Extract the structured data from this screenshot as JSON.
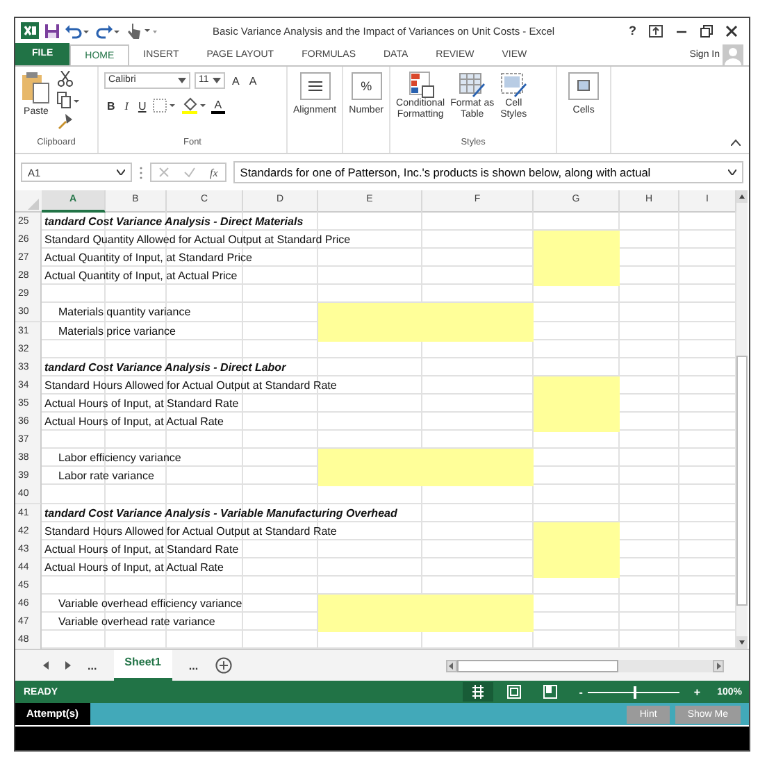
{
  "window": {
    "title": "Basic Variance Analysis and the Impact of Variances on Unit Costs - Excel",
    "help": "?"
  },
  "tabs": [
    {
      "label": "FILE",
      "kind": "file",
      "selected": false
    },
    {
      "label": "HOME",
      "kind": "tab",
      "selected": true
    },
    {
      "label": "INSERT",
      "kind": "tab",
      "selected": false
    },
    {
      "label": "PAGE LAYOUT",
      "kind": "tab",
      "selected": false
    },
    {
      "label": "FORMULAS",
      "kind": "tab",
      "selected": false
    },
    {
      "label": "DATA",
      "kind": "tab",
      "selected": false
    },
    {
      "label": "REVIEW",
      "kind": "tab",
      "selected": false
    },
    {
      "label": "VIEW",
      "kind": "tab",
      "selected": false
    }
  ],
  "sign_in": "Sign In",
  "ribbon": {
    "clipboard": {
      "label": "Clipboard",
      "paste": "Paste"
    },
    "font": {
      "label": "Font",
      "name": "Calibri",
      "size": "11",
      "grow": "A",
      "shrink": "A",
      "bold": "B",
      "italic": "I",
      "underline": "U",
      "color_letter": "A"
    },
    "alignment": "Alignment",
    "number": {
      "label": "Number",
      "symbol": "%"
    },
    "styles": {
      "label": "Styles",
      "buttons": [
        {
          "lines": [
            "Conditional",
            "Formatting"
          ],
          "kind": "conditional"
        },
        {
          "lines": [
            "Format as",
            "Table"
          ],
          "kind": "table"
        },
        {
          "lines": [
            "Cell",
            "Styles"
          ],
          "kind": "cellstyles"
        }
      ]
    },
    "cells": "Cells"
  },
  "formula_bar": {
    "name_box": "A1",
    "fx": "fx",
    "formula": "Standards for one of Patterson, Inc.'s products is shown below, along with actual"
  },
  "columns": [
    {
      "label": "A",
      "selected": true
    },
    {
      "label": "B",
      "selected": false
    },
    {
      "label": "C",
      "selected": false
    },
    {
      "label": "D",
      "selected": false
    },
    {
      "label": "E",
      "selected": false
    },
    {
      "label": "F",
      "selected": false
    },
    {
      "label": "G",
      "selected": false
    },
    {
      "label": "H",
      "selected": false
    },
    {
      "label": "I",
      "selected": false
    }
  ],
  "rows": [
    {
      "number": "25",
      "kind": "heading",
      "text": "tandard Cost Variance Analysis - Direct Materials"
    },
    {
      "number": "26",
      "kind": "item",
      "text": "Standard Quantity Allowed for Actual Output at Standard Price",
      "input_cell": true
    },
    {
      "number": "27",
      "kind": "item",
      "text": "Actual Quantity of Input, at Standard Price",
      "input_cell": true
    },
    {
      "number": "28",
      "kind": "item",
      "text": "Actual Quantity of Input, at Actual Price",
      "input_cell": true
    },
    {
      "number": "29",
      "kind": "blank"
    },
    {
      "number": "30",
      "kind": "variance",
      "text": "Materials quantity variance",
      "input_cell": true
    },
    {
      "number": "31",
      "kind": "variance",
      "text": "Materials price variance",
      "input_cell": true
    },
    {
      "number": "32",
      "kind": "blank"
    },
    {
      "number": "33",
      "kind": "heading",
      "text": "tandard Cost Variance Analysis - Direct Labor"
    },
    {
      "number": "34",
      "kind": "item",
      "text": "Standard Hours Allowed for Actual Output at Standard Rate",
      "input_cell": true
    },
    {
      "number": "35",
      "kind": "item",
      "text": "Actual Hours of Input, at Standard Rate",
      "input_cell": true
    },
    {
      "number": "36",
      "kind": "item",
      "text": "Actual Hours of Input, at Actual Rate",
      "input_cell": true
    },
    {
      "number": "37",
      "kind": "blank"
    },
    {
      "number": "38",
      "kind": "variance",
      "text": "Labor efficiency variance",
      "input_cell": true
    },
    {
      "number": "39",
      "kind": "variance",
      "text": "Labor rate variance",
      "input_cell": true
    },
    {
      "number": "40",
      "kind": "blank"
    },
    {
      "number": "41",
      "kind": "heading",
      "text": "tandard Cost Variance Analysis - Variable Manufacturing Overhead"
    },
    {
      "number": "42",
      "kind": "item",
      "text": "Standard Hours Allowed for Actual Output at Standard Rate",
      "input_cell": true
    },
    {
      "number": "43",
      "kind": "item",
      "text": "Actual Hours of Input, at Standard Rate",
      "input_cell": true
    },
    {
      "number": "44",
      "kind": "item",
      "text": "Actual Hours of Input, at Actual Rate",
      "input_cell": true
    },
    {
      "number": "45",
      "kind": "blank"
    },
    {
      "number": "46",
      "kind": "variance",
      "text": "Variable overhead efficiency variance",
      "input_cell": true
    },
    {
      "number": "47",
      "kind": "variance",
      "text": "Variable overhead rate variance",
      "input_cell": true
    },
    {
      "number": "48",
      "kind": "blank"
    }
  ],
  "sheet_tabs": {
    "before": "...",
    "sheets": [
      {
        "label": "Sheet1",
        "selected": true
      }
    ],
    "after": "..."
  },
  "status_bar": {
    "text": "READY",
    "minus": "-",
    "plus": "+",
    "zoom": {
      "level": 0.5
    },
    "zoom_label": "100%"
  },
  "attempt_bar": {
    "label": "Attempt(s)",
    "buttons": [
      {
        "label": "Hint",
        "disabled": true
      },
      {
        "label": "Show Me",
        "disabled": true
      }
    ]
  }
}
